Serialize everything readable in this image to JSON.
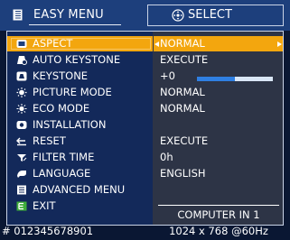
{
  "header": {
    "title": "EASY MENU",
    "select_hint": "SELECT"
  },
  "menu": {
    "items": [
      {
        "label": "ASPECT",
        "value": "NORMAL"
      },
      {
        "label": "AUTO KEYSTONE",
        "value": "EXECUTE"
      },
      {
        "label": "KEYSTONE",
        "value": "+0"
      },
      {
        "label": "PICTURE MODE",
        "value": "NORMAL"
      },
      {
        "label": "ECO MODE",
        "value": "NORMAL"
      },
      {
        "label": "INSTALLATION",
        "value": ""
      },
      {
        "label": "RESET",
        "value": "EXECUTE"
      },
      {
        "label": "FILTER TIME",
        "value": "0h"
      },
      {
        "label": "LANGUAGE",
        "value": "ENGLISH"
      },
      {
        "label": "ADVANCED MENU",
        "value": ""
      },
      {
        "label": "EXIT",
        "value": ""
      }
    ],
    "selected": "ASPECT"
  },
  "keystone_slider": {
    "value": 0,
    "level": 0.5
  },
  "footer": {
    "serial": "# 012345678901",
    "input_source": "COMPUTER IN 1",
    "signal": "1024 x 768 @60Hz"
  },
  "colors": {
    "background": "#0a1733",
    "header": "#1d3f7c",
    "panel": "#13295a",
    "value_column": "#2d3446",
    "highlight": "#f3a60e",
    "slider_fill": "#2f7fe2"
  },
  "icons": [
    "menu-book-icon",
    "select-pad-icon",
    "aspect-icon",
    "auto-keystone-icon",
    "keystone-icon",
    "picture-mode-icon",
    "eco-mode-icon",
    "installation-icon",
    "reset-icon",
    "filter-time-icon",
    "language-icon",
    "advanced-menu-icon",
    "exit-icon"
  ]
}
